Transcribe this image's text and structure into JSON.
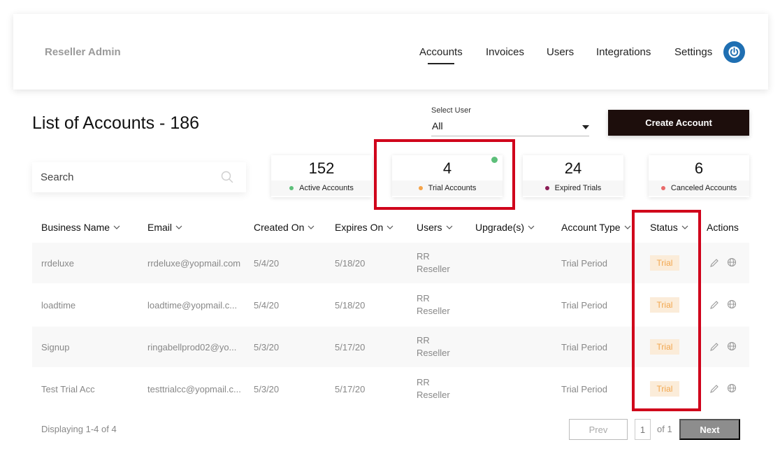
{
  "header": {
    "brand": "Reseller Admin",
    "nav": [
      {
        "label": "Accounts",
        "active": true
      },
      {
        "label": "Invoices",
        "active": false
      },
      {
        "label": "Users",
        "active": false
      },
      {
        "label": "Integrations",
        "active": false
      },
      {
        "label": "Settings",
        "active": false
      }
    ],
    "power_icon": "power-icon"
  },
  "page": {
    "title": "List of Accounts - 186",
    "select_user_label": "Select User",
    "select_user_value": "All",
    "create_button": "Create Account",
    "search_placeholder": "Search"
  },
  "stats": [
    {
      "value": "152",
      "label": "Active Accounts",
      "dot_color": "#5dbf7a"
    },
    {
      "value": "4",
      "label": "Trial Accounts",
      "dot_color": "#f5a44a",
      "selected": true
    },
    {
      "value": "24",
      "label": "Expired Trials",
      "dot_color": "#8a1c55"
    },
    {
      "value": "6",
      "label": "Canceled Accounts",
      "dot_color": "#e86a6a"
    }
  ],
  "table": {
    "columns": [
      "Business Name",
      "Email",
      "Created On",
      "Expires On",
      "Users",
      "Upgrade(s)",
      "Account Type",
      "Status",
      "Actions"
    ],
    "rows": [
      {
        "business": "rrdeluxe",
        "email": "rrdeluxe@yopmail.com",
        "created": "5/4/20",
        "expires": "5/18/20",
        "users_1": "RR",
        "users_2": "Reseller",
        "upgrades": "",
        "type": "Trial Period",
        "status": "Trial"
      },
      {
        "business": "loadtime",
        "email": "loadtime@yopmail.c...",
        "created": "5/4/20",
        "expires": "5/18/20",
        "users_1": "RR",
        "users_2": "Reseller",
        "upgrades": "",
        "type": "Trial Period",
        "status": "Trial"
      },
      {
        "business": "Signup",
        "email": "ringabellprod02@yo...",
        "created": "5/3/20",
        "expires": "5/17/20",
        "users_1": "RR",
        "users_2": "Reseller",
        "upgrades": "",
        "type": "Trial Period",
        "status": "Trial"
      },
      {
        "business": "Test Trial Acc",
        "email": "testtrialcc@yopmail.c...",
        "created": "5/3/20",
        "expires": "5/17/20",
        "users_1": "RR",
        "users_2": "Reseller",
        "upgrades": "",
        "type": "Trial Period",
        "status": "Trial"
      }
    ]
  },
  "footer": {
    "displaying": "Displaying 1-4 of 4",
    "prev": "Prev",
    "page": "1",
    "of": "of 1",
    "next": "Next"
  },
  "colors": {
    "accent_dark": "#1d0e0c",
    "highlight_red": "#d0021b",
    "trial_badge_bg": "#fbecd9",
    "trial_badge_text": "#f2a64d"
  }
}
